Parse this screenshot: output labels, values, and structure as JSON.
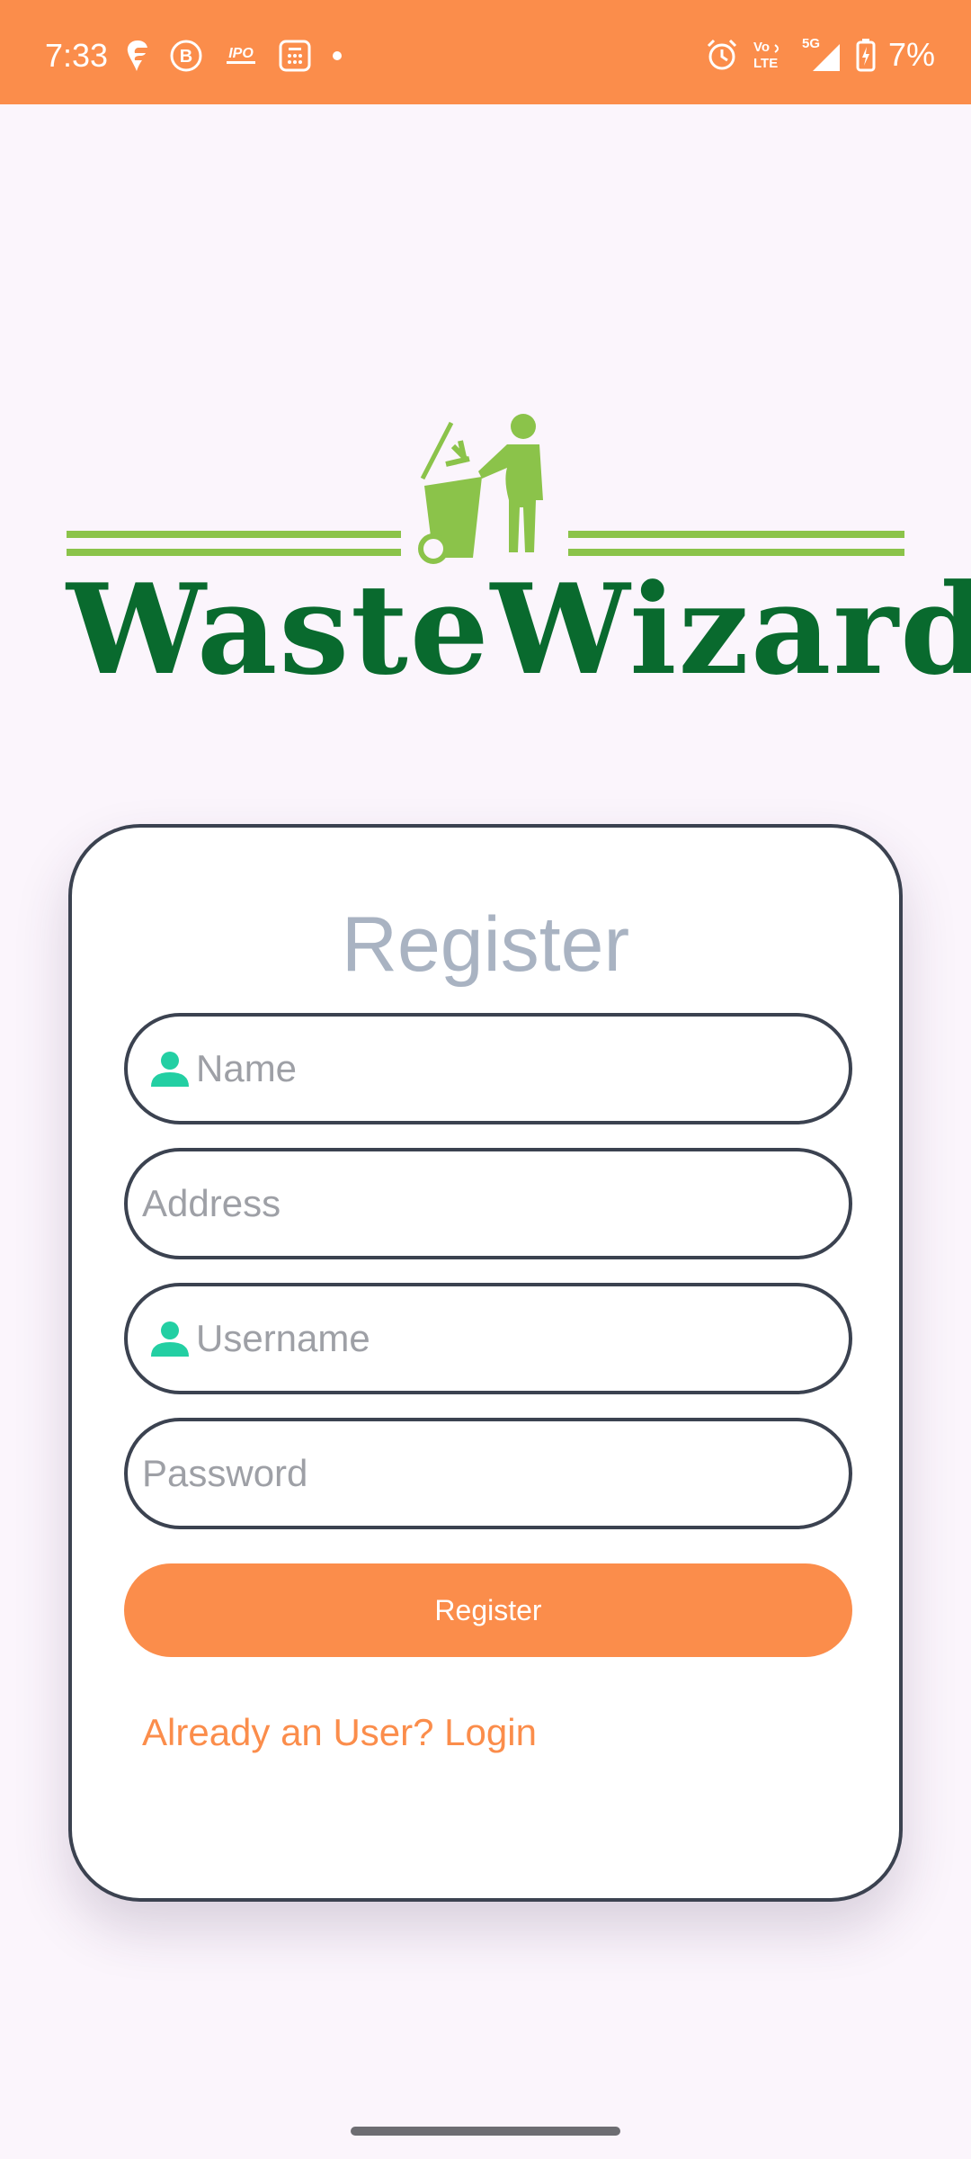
{
  "status_bar": {
    "time": "7:33",
    "left_icons": [
      "swiggy-icon",
      "b-icon",
      "ipo-icon",
      "calculator-icon",
      "dot-icon"
    ],
    "ipo_label": "IPO",
    "b_label": "B",
    "network_label": "Vo\nLTE",
    "network_vo": "Vo",
    "network_lte": "LTE",
    "network_5g": "5G",
    "battery": "7%"
  },
  "logo": {
    "text": "WasteWizard",
    "colors": {
      "wordmark": "#096a2e",
      "accent": "#8bc34a"
    }
  },
  "register_card": {
    "title": "Register",
    "fields": [
      {
        "placeholder": "Name",
        "icon": "person-icon"
      },
      {
        "placeholder": "Address",
        "icon": ""
      },
      {
        "placeholder": "Username",
        "icon": "person-icon"
      },
      {
        "placeholder": "Password",
        "icon": ""
      }
    ],
    "register_button": "Register",
    "login_link": "Already an User? Login"
  },
  "colors": {
    "primary": "#fb8d4b",
    "field_border": "#3b4250",
    "icon_teal": "#23cfa3",
    "background": "#fbf5fc"
  }
}
